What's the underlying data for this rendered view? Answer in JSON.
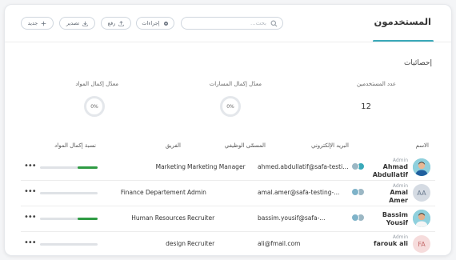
{
  "header": {
    "title": "المستخدمون",
    "search_placeholder": "بحث...",
    "buttons": {
      "actions": "إجراءات",
      "upload": "رفع",
      "export": "تصدير",
      "new": "جديد"
    }
  },
  "stats": {
    "title": "إحصائيات",
    "users_count_label": "عدد المستخدمين",
    "users_count_value": "12",
    "paths_rate_label": "معدّل إكمال المسارات",
    "paths_rate_value": "0%",
    "materials_rate_label": "معدّل إكمال المواد",
    "materials_rate_value": "0%"
  },
  "table": {
    "columns": {
      "name": "الاسم",
      "email": "البريد الإلكتروني",
      "job": "المسمّى الوظيفي",
      "team": "الفريق",
      "completion": "نسبة إكمال المواد"
    },
    "rows": [
      {
        "role": "Admin",
        "name": "Ahmad Abdullatif",
        "email": "ahmed.abdullatif@safa-testing...",
        "job": "Marketing Manager",
        "team": "Marketing",
        "avatar": "photo-man-blue",
        "completion": 0.35,
        "badges": 2
      },
      {
        "role": "Admin",
        "name": "Amal Amer",
        "email": "amal.amer@safa-testing-...",
        "job": "Admin",
        "team": "Finance Departement",
        "avatar": "AA",
        "completion": 0,
        "badges": 2
      },
      {
        "role": "",
        "name": "Bassim Yousif",
        "email": "bassim.yousif@safa-...",
        "job": "Recruiter",
        "team": "Human Resources",
        "avatar": "photo-man-white",
        "completion": 0.35,
        "badges": 2
      },
      {
        "role": "Admin",
        "name": "farouk ali",
        "email": "ali@fmail.com",
        "job": "Recruiter",
        "team": "design",
        "avatar": "FA",
        "completion": 0,
        "badges": 0
      }
    ]
  },
  "colors": {
    "accent": "#3aa9b9",
    "progress": "#2e9b43",
    "avatar_aa_bg": "#d5dbe3",
    "avatar_fa_bg": "#f6dcdc"
  }
}
